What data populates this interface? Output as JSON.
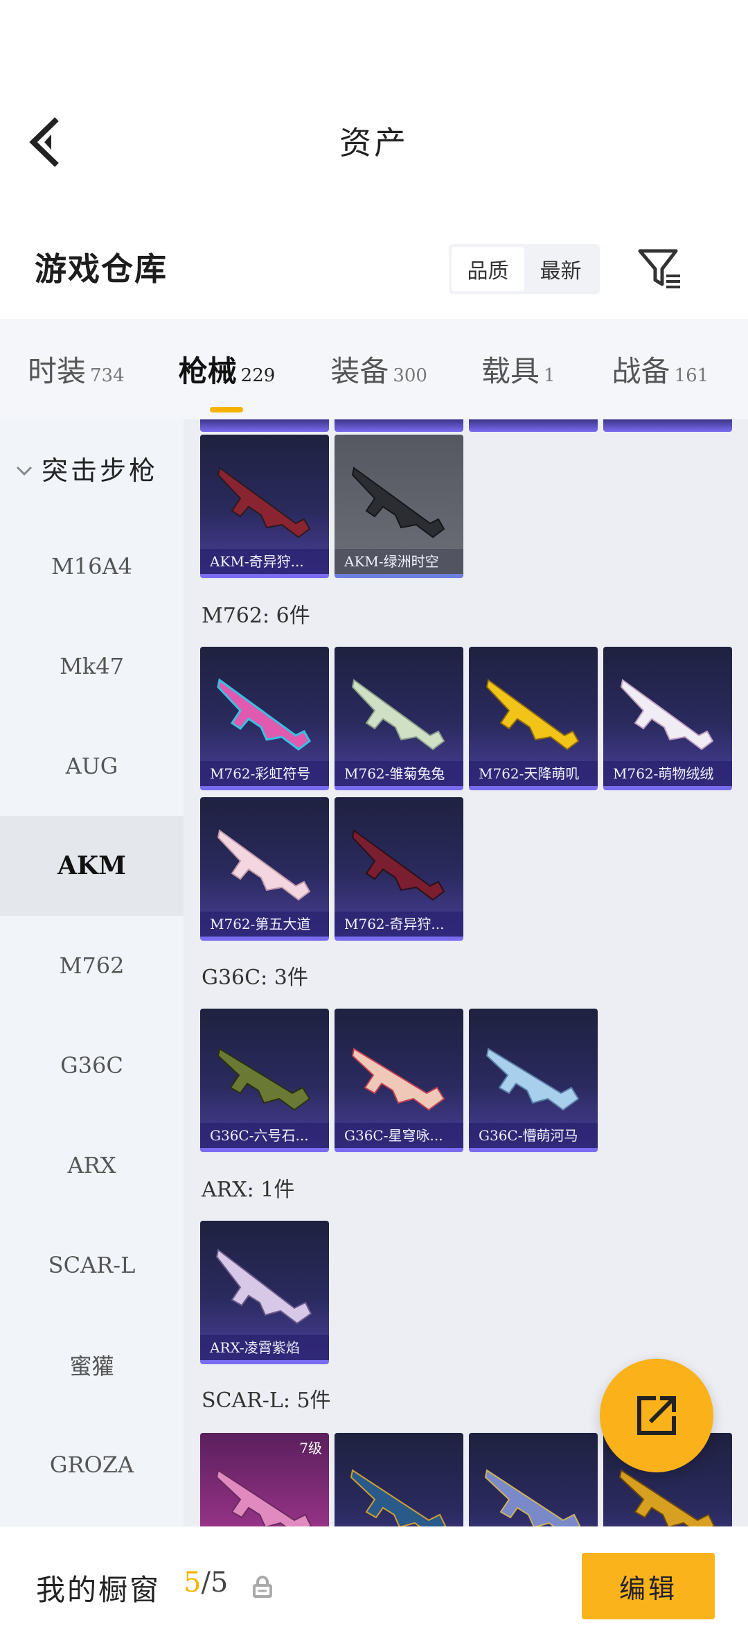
{
  "header": {
    "title": "资产"
  },
  "warehouse": {
    "title": "游戏仓库",
    "sort_options": [
      "品质",
      "最新"
    ],
    "sort_active": "品质"
  },
  "tabs": [
    {
      "label": "时装",
      "count": "734"
    },
    {
      "label": "枪械",
      "count": "229",
      "active": true
    },
    {
      "label": "装备",
      "count": "300"
    },
    {
      "label": "载具",
      "count": "1"
    },
    {
      "label": "战备",
      "count": "161"
    }
  ],
  "sidebar": {
    "group": "突击步枪",
    "items": [
      "M16A4",
      "Mk47",
      "AUG",
      "AKM",
      "M762",
      "G36C",
      "ARX",
      "SCAR-L",
      "蜜獾",
      "GROZA"
    ],
    "active": "AKM"
  },
  "sections": {
    "akm": {
      "items": [
        "AKM-奇异狩...",
        "AKM-绿洲时空"
      ]
    },
    "m762": {
      "label": "M762: 6件",
      "items": [
        "M762-彩虹符号",
        "M762-雏菊兔兔",
        "M762-天降萌叽",
        "M762-萌物绒绒",
        "M762-第五大道",
        "M762-奇异狩..."
      ]
    },
    "g36c": {
      "label": "G36C: 3件",
      "items": [
        "G36C-六号石...",
        "G36C-星穹咏...",
        "G36C-懵萌河马"
      ]
    },
    "arx": {
      "label": "ARX: 1件",
      "items": [
        "ARX-凌霄紫焰"
      ]
    },
    "scarl": {
      "label": "SCAR-L: 5件",
      "grade": "7级"
    }
  },
  "bottom": {
    "label": "我的橱窗",
    "count_current": "5",
    "count_sep": "/5",
    "edit": "编辑"
  },
  "colors": {
    "accent": "#fbb31c",
    "card_purple": "#2a2a5e",
    "card_border": "#7a6cf0"
  },
  "icons": [
    "back-arrow-icon",
    "filter-icon",
    "chevron-down-icon",
    "lock-icon",
    "share-icon"
  ]
}
